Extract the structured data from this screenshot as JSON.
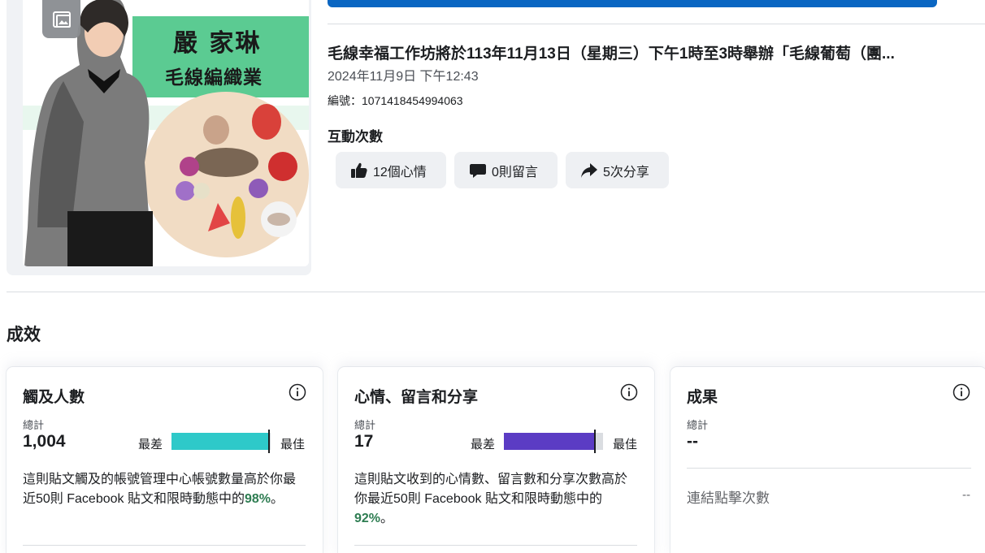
{
  "thumbnail": {
    "title": "嚴 家琳",
    "subtitle": "毛線編織業"
  },
  "post": {
    "text": "毛線幸福工作坊將於113年11月13日（星期三）下午1時至3時舉辦「毛線葡萄（團...",
    "date": "2024年11月9日 下午12:43",
    "id_label": "編號：1071418454994063"
  },
  "interactions": {
    "title": "互動次數",
    "reactions": "12個心情",
    "comments": "0則留言",
    "shares": "5次分享"
  },
  "performance": {
    "title": "成效",
    "cards": [
      {
        "title": "觸及人數",
        "sublabel": "總計",
        "value": "1,004",
        "worst": "最差",
        "best": "最佳",
        "percentile": 0.98,
        "bar_color": "#2ec9c9",
        "desc_prefix": "這則貼文觸及的帳號管理中心帳號數量高於你最近50則 Facebook 貼文和限時動態中的",
        "pct": "98%",
        "desc_suffix": "。"
      },
      {
        "title": "心情、留言和分享",
        "sublabel": "總計",
        "value": "17",
        "worst": "最差",
        "best": "最佳",
        "percentile": 0.92,
        "bar_color": "#5b3cc4",
        "desc_prefix": "這則貼文收到的心情數、留言數和分享次數高於你最近50則 Facebook 貼文和限時動態中的",
        "pct": "92%",
        "desc_suffix": "。"
      },
      {
        "title": "成果",
        "sublabel": "總計",
        "value": "--",
        "row_label": "連結點擊次數",
        "row_value": "--"
      }
    ]
  },
  "colors": {
    "accent": "#0a66c2",
    "positive": "#2e7d52"
  }
}
